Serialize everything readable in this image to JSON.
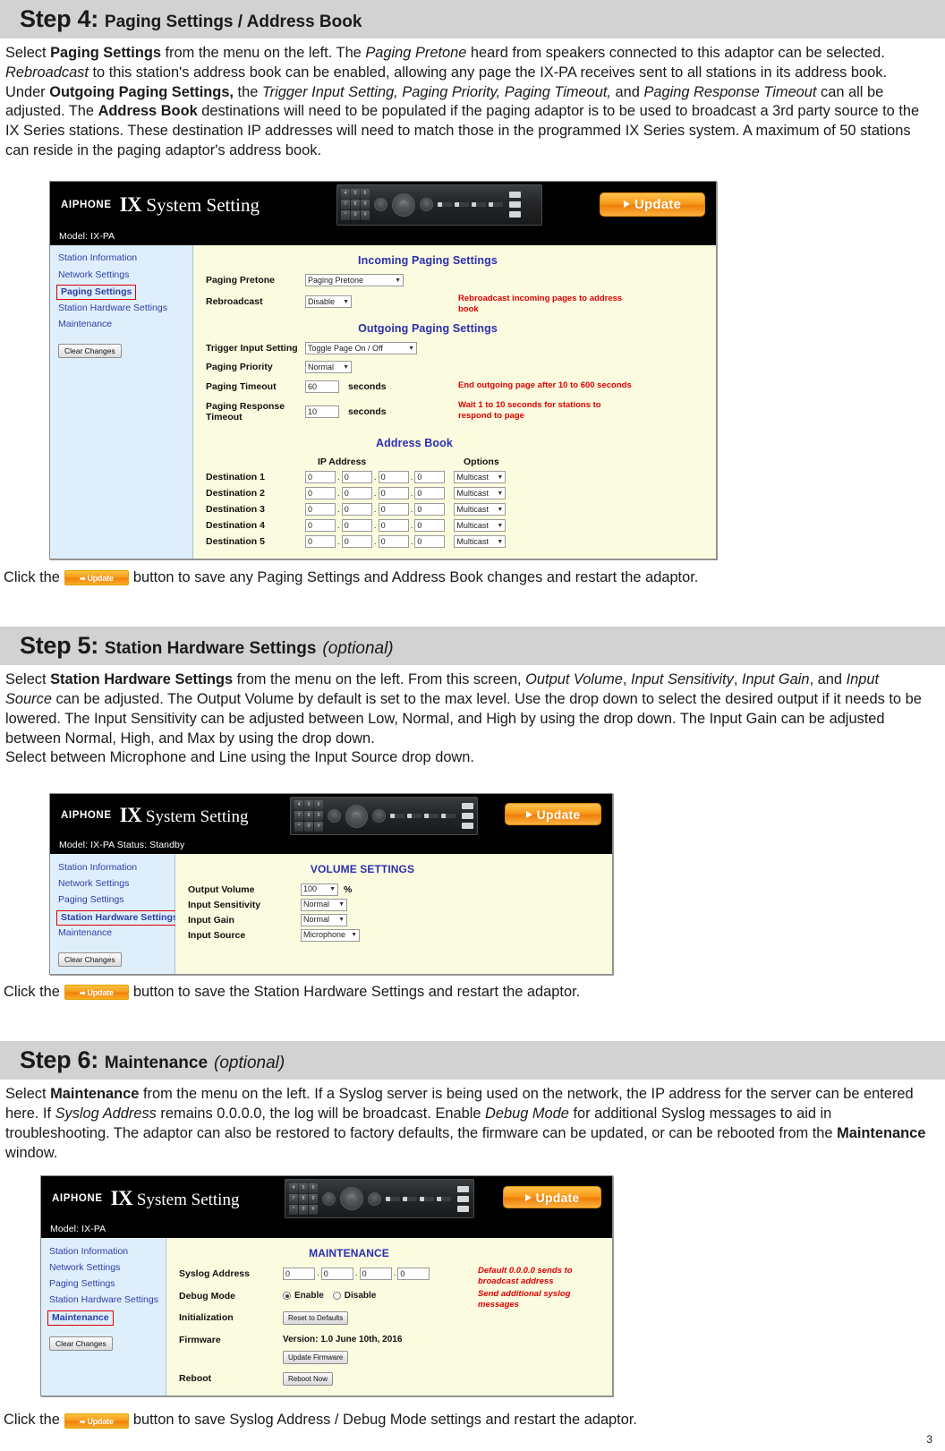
{
  "step4": {
    "num": "Step 4:",
    "title": "Paging Settings / Address Book",
    "paragraph_html": "Select <b>Paging Settings</b> from the menu on the left. The <i>Paging Pretone</i> heard from speakers connected to this adaptor can be selected. <i>Rebroadcast</i> to this station's address book can be enabled, allowing any page the IX-PA receives sent to all stations in its address book. Under <b>Outgoing Paging Settings,</b> the <i>Trigger Input Setting, Paging Priority, Paging Timeout,</i> and <i>Paging Response Timeout</i> can all be adjusted. The <b>Address Book</b> destinations will need to be populated if the paging adaptor is to be used to broadcast a 3rd party source to the IX Series stations. These destination IP addresses will need to match those in the programmed IX Series system. A maximum of 50 stations can reside in the paging adaptor's address book.",
    "caption_before": "Click the",
    "caption_after": "button to save any Paging Settings and Address Book changes and restart the adaptor."
  },
  "step5": {
    "num": "Step 5:",
    "title": "Station Hardware Settings",
    "optional": "(optional)",
    "paragraph_html": "Select <b>Station Hardware Settings</b> from the menu on the left. From this screen, <i>Output Volume</i>, <i>Input Sensitivity</i>, <i>Input Gain</i>, and <i>Input Source</i> can be adjusted. The Output Volume by default is set to the max level. Use the drop down to select the desired output if it needs to be lowered. The Input Sensitivity can be adjusted between Low, Normal, and High by using the drop down. The Input Gain can be adjusted between Normal, High, and Max by using the drop down.<br>Select between Microphone and Line using the Input Source drop down.",
    "caption_before": "Click the",
    "caption_after": "button to save the Station Hardware Settings and restart the adaptor."
  },
  "step6": {
    "num": "Step 6:",
    "title": "Maintenance",
    "optional": "(optional)",
    "paragraph_html": "Select <b>Maintenance</b> from the menu on the left. If a Syslog server is being used on the network, the IP address for the server can be entered here. If <i>Syslog Address</i> remains 0.0.0.0, the log will be broadcast. Enable <i>Debug Mode</i> for additional Syslog messages to aid in troubleshooting. The adaptor can also be restored to factory defaults, the firmware can be updated, or can be rebooted from the <b>Maintenance</b> window.",
    "caption_before": "Click the",
    "caption_after": "button to save Syslog Address / Debug Mode settings and restart the adaptor."
  },
  "app": {
    "brand": "AIPHONE",
    "title_ix": "IX",
    "title_rest": "System Setting",
    "update_label": "Update",
    "nav_items": [
      "Station Information",
      "Network Settings",
      "Paging Settings",
      "Station Hardware Settings",
      "Maintenance"
    ],
    "clear_changes": "Clear Changes"
  },
  "shot_paging": {
    "model": "Model: IX-PA",
    "selected_nav": "Paging Settings",
    "incoming_title": "Incoming Paging Settings",
    "outgoing_title": "Outgoing Paging Settings",
    "address_book_title": "Address Book",
    "fields": {
      "paging_pretone_label": "Paging Pretone",
      "paging_pretone_value": "Paging Pretone",
      "rebroadcast_label": "Rebroadcast",
      "rebroadcast_value": "Disable",
      "rebroadcast_note": "Rebroadcast incoming pages to address book",
      "trigger_label": "Trigger Input Setting",
      "trigger_value": "Toggle Page On / Off",
      "priority_label": "Paging Priority",
      "priority_value": "Normal",
      "timeout_label": "Paging Timeout",
      "timeout_value": "60",
      "timeout_unit": "seconds",
      "timeout_note": "End outgoing page after 10 to 600 seconds",
      "resp_label": "Paging Response Timeout",
      "resp_value": "10",
      "resp_unit": "seconds",
      "resp_note": "Wait 1 to 10 seconds for stations to respond to page"
    },
    "address_book": {
      "col_ip": "IP Address",
      "col_options": "Options",
      "rows": [
        {
          "label": "Destination 1",
          "o1": "0",
          "o2": "0",
          "o3": "0",
          "o4": "0",
          "option": "Multicast"
        },
        {
          "label": "Destination 2",
          "o1": "0",
          "o2": "0",
          "o3": "0",
          "o4": "0",
          "option": "Multicast"
        },
        {
          "label": "Destination 3",
          "o1": "0",
          "o2": "0",
          "o3": "0",
          "o4": "0",
          "option": "Multicast"
        },
        {
          "label": "Destination 4",
          "o1": "0",
          "o2": "0",
          "o3": "0",
          "o4": "0",
          "option": "Multicast"
        },
        {
          "label": "Destination 5",
          "o1": "0",
          "o2": "0",
          "o3": "0",
          "o4": "0",
          "option": "Multicast"
        }
      ]
    }
  },
  "shot_hardware": {
    "model": "Model: IX-PA   Status: Standby",
    "selected_nav": "Station Hardware Settings",
    "section_title": "VOLUME SETTINGS",
    "fields": {
      "output_volume_label": "Output Volume",
      "output_volume_value": "100",
      "output_volume_unit": "%",
      "input_sensitivity_label": "Input Sensitivity",
      "input_sensitivity_value": "Normal",
      "input_gain_label": "Input Gain",
      "input_gain_value": "Normal",
      "input_source_label": "Input Source",
      "input_source_value": "Microphone"
    }
  },
  "shot_maintenance": {
    "model": "Model: IX-PA",
    "selected_nav": "Maintenance",
    "section_title": "MAINTENANCE",
    "fields": {
      "syslog_label": "Syslog Address",
      "syslog_o1": "0",
      "syslog_o2": "0",
      "syslog_o3": "0",
      "syslog_o4": "0",
      "syslog_note": "Default 0.0.0.0 sends to broadcast address",
      "debug_label": "Debug Mode",
      "debug_enable": "Enable",
      "debug_disable": "Disable",
      "debug_note": "Send additional syslog messages",
      "init_label": "Initialization",
      "init_button": "Reset to Defaults",
      "firmware_label": "Firmware",
      "firmware_version": "Version: 1.0 June 10th, 2016",
      "firmware_button": "Update Firmware",
      "reboot_label": "Reboot",
      "reboot_button": "Reboot Now"
    }
  },
  "footer": {
    "page_number": "3"
  }
}
